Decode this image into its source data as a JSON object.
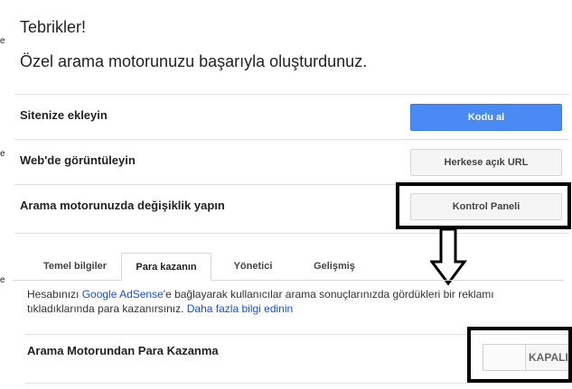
{
  "header": {
    "title": "Tebrikler!",
    "subtitle": "Özel arama motorunuzu başarıyla oluşturdunuz."
  },
  "rows": [
    {
      "label": "Sitenize ekleyin",
      "button": "Kodu al"
    },
    {
      "label": "Web'de görüntüleyin",
      "button": "Herkese açık URL"
    },
    {
      "label": "Arama motorunuzda değişiklik yapın",
      "button": "Kontrol Paneli"
    }
  ],
  "tabs": [
    "Temel bilgiler",
    "Para kazanın",
    "Yönetici",
    "Gelişmiş"
  ],
  "active_tab": "Para kazanın",
  "adsense": {
    "text_before": "Hesabınızı ",
    "link1": "Google AdSense",
    "text_middle": "'e bağlayarak kullanıcılar arama sonuçlarınızda gördükleri bir reklamı tıkladıklarında para kazanırsınız. ",
    "link2": "Daha fazla bilgi edinin"
  },
  "monetize": {
    "label": "Arama Motorundan Para Kazanma",
    "toggle_state": "KAPALI"
  },
  "edge_marks": [
    "e",
    "e",
    "e"
  ],
  "colors": {
    "primary_button": "#4a8af4",
    "link": "#1a4fcf",
    "annotation": "#000000"
  }
}
